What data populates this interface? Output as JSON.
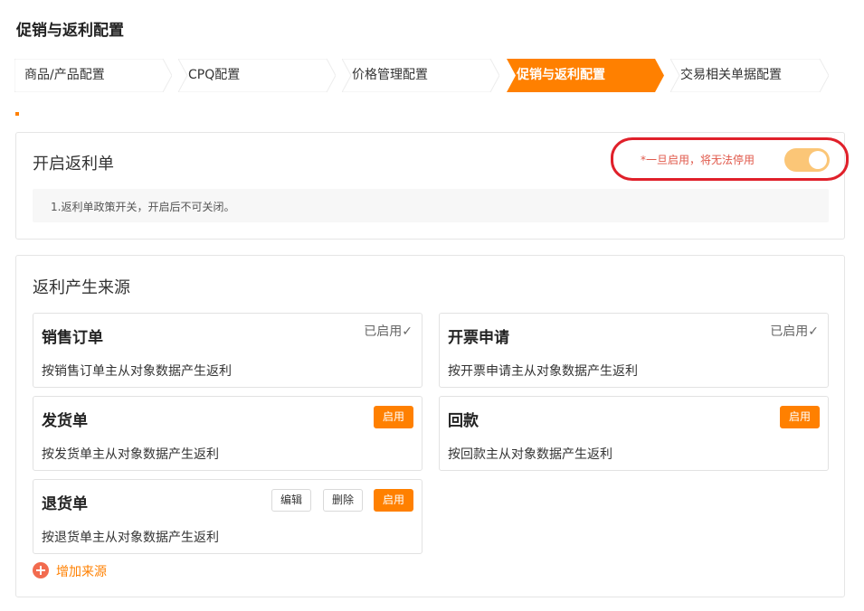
{
  "page": {
    "title": "促销与返利配置"
  },
  "steps": [
    {
      "label": "商品/产品配置",
      "active": false
    },
    {
      "label": "CPQ配置",
      "active": false
    },
    {
      "label": "价格管理配置",
      "active": false
    },
    {
      "label": "促销与返利配置",
      "active": true
    },
    {
      "label": "交易相关单据配置",
      "active": false
    }
  ],
  "rebate_panel": {
    "title": "开启返利单",
    "warning": "*一旦启用，将无法停用",
    "toggle_on": true,
    "description": "1.返利单政策开关，开启后不可关闭。"
  },
  "sources_panel": {
    "title": "返利产生来源",
    "cards": [
      {
        "title": "销售订单",
        "description": "按销售订单主从对象数据产生返利",
        "status": "已启用✓"
      },
      {
        "title": "开票申请",
        "description": "按开票申请主从对象数据产生返利",
        "status": "已启用✓"
      },
      {
        "title": "发货单",
        "description": "按发货单主从对象数据产生返利",
        "enable_label": "启用"
      },
      {
        "title": "回款",
        "description": "按回款主从对象数据产生返利",
        "enable_label": "启用"
      },
      {
        "title": "退货单",
        "description": "按退货单主从对象数据产生返利",
        "edit_label": "编辑",
        "delete_label": "删除",
        "enable_label": "启用"
      }
    ],
    "add_source_label": "增加来源"
  },
  "colors": {
    "accent": "#ff8000",
    "tab_inactive_bg": "#ffffff",
    "toggle_on": "#fbc677",
    "warning_text": "#e0584a",
    "highlight_outline": "#e0202a"
  }
}
